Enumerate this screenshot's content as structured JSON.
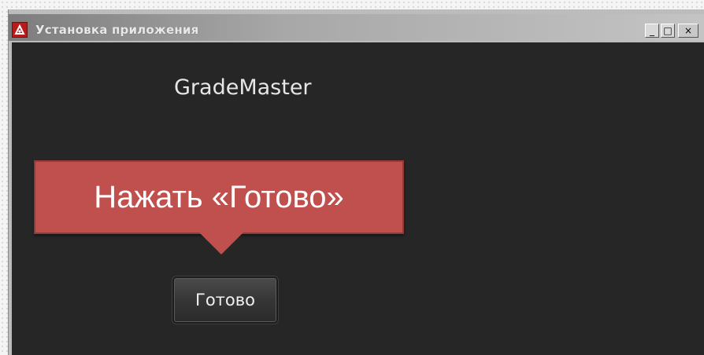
{
  "window": {
    "title": "Установка приложения",
    "controls": {
      "minimize": "_",
      "maximize": "□",
      "close": "×"
    }
  },
  "app": {
    "name": "GradeMaster"
  },
  "callout": {
    "text": "Нажать «Готово»",
    "color": "#c0504d"
  },
  "actions": {
    "done_label": "Готово"
  },
  "icons": {
    "app": "app-logo-icon"
  }
}
